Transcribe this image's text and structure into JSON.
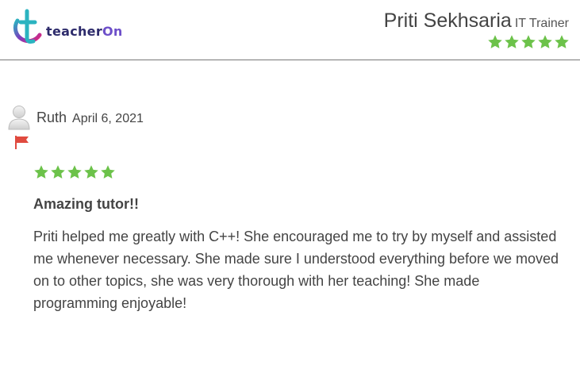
{
  "brand": {
    "logo_text_main": "teacher",
    "logo_text_accent": "On"
  },
  "tutor": {
    "name": "Priti Sekhsaria",
    "role": "IT Trainer",
    "rating": 5,
    "rating_max": 5,
    "star_color": "#6cc24a"
  },
  "review": {
    "author": "Ruth",
    "date": "April 6, 2021",
    "rating": 5,
    "rating_max": 5,
    "title": "Amazing tutor!!",
    "body": "Priti helped me greatly with C++! She encouraged me to try by myself and assisted me whenever necessary. She made sure I understood everything before we moved on to other topics, she was very thorough with her teaching! She made programming enjoyable!",
    "flag_color": "#e04a3f"
  }
}
